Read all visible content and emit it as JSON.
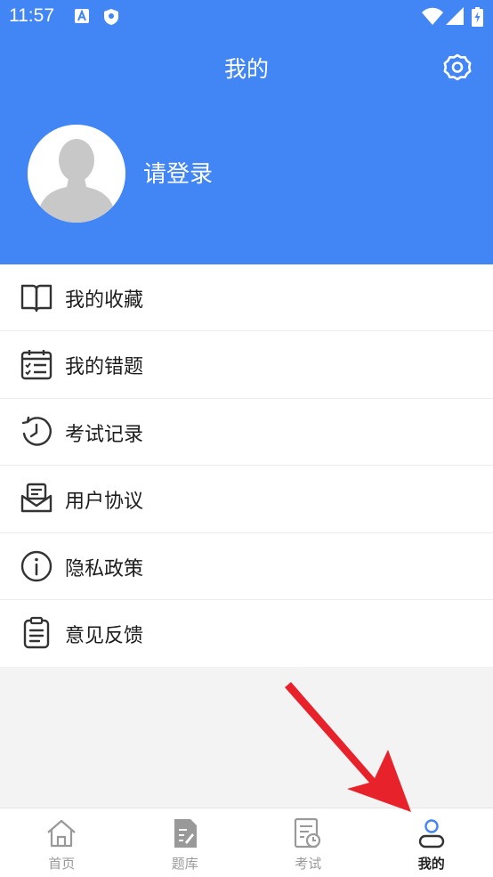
{
  "status_bar": {
    "time": "11:57"
  },
  "header": {
    "title": "我的"
  },
  "profile": {
    "login_label": "请登录"
  },
  "menu": {
    "items": [
      {
        "label": "我的收藏",
        "icon": "book-icon"
      },
      {
        "label": "我的错题",
        "icon": "calendar-checklist-icon"
      },
      {
        "label": "考试记录",
        "icon": "history-clock-icon"
      },
      {
        "label": "用户协议",
        "icon": "envelope-document-icon"
      },
      {
        "label": "隐私政策",
        "icon": "info-icon"
      },
      {
        "label": "意见反馈",
        "icon": "clipboard-icon"
      }
    ]
  },
  "tabbar": {
    "tabs": [
      {
        "label": "首页",
        "icon": "home-icon"
      },
      {
        "label": "题库",
        "icon": "question-bank-icon"
      },
      {
        "label": "考试",
        "icon": "exam-icon"
      },
      {
        "label": "我的",
        "icon": "user-icon",
        "active": true
      }
    ]
  },
  "colors": {
    "primary": "#4285f4",
    "tab_active": "#4285f4",
    "annotation_arrow": "#e8222b"
  }
}
